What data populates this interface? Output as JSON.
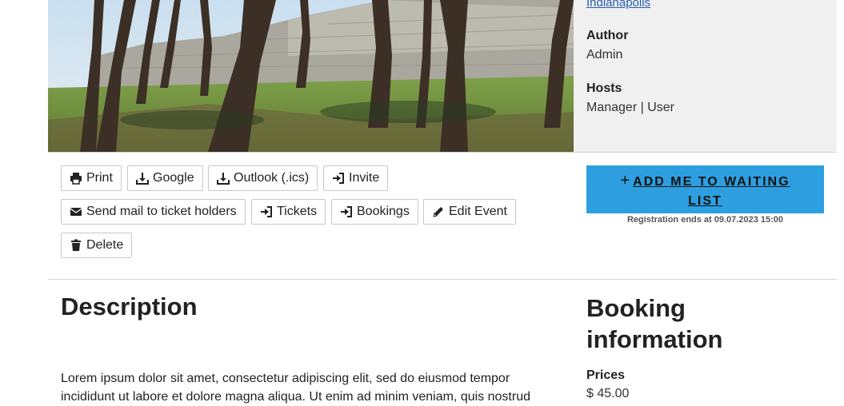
{
  "event": {
    "location_link": "Indianapolis",
    "author_label": "Author",
    "author_value": "Admin",
    "hosts_label": "Hosts",
    "hosts_value": "Manager | User"
  },
  "actions": {
    "print": "Print",
    "google": "Google",
    "outlook": "Outlook (.ics)",
    "invite": "Invite",
    "send_mail": "Send mail to ticket holders",
    "tickets": "Tickets",
    "bookings": "Bookings",
    "edit_event": "Edit Event",
    "delete": "Delete"
  },
  "registration": {
    "button_line1": "ADD ME TO WAITING",
    "button_line2": "LIST",
    "note": "Registration ends at 09.07.2023 15:00"
  },
  "description": {
    "heading": "Description",
    "body": "Lorem ipsum dolor sit amet, consectetur adipiscing elit, sed do eiusmod tempor incididunt ut labore et dolore magna aliqua. Ut enim ad minim veniam, quis nostrud"
  },
  "booking_info": {
    "heading": "Booking information",
    "prices_label": "Prices",
    "price_value": "$ 45.00"
  },
  "icons": {
    "print": "printer-icon",
    "google": "download-icon",
    "outlook": "download-icon",
    "invite": "sign-in-icon",
    "send_mail": "envelope-icon",
    "tickets": "sign-in-icon",
    "bookings": "sign-in-icon",
    "edit_event": "pencil-icon",
    "delete": "trash-icon"
  },
  "colors": {
    "cta": "#2d9fe0",
    "link": "#2a5db0",
    "panel": "#f0f0f0"
  }
}
